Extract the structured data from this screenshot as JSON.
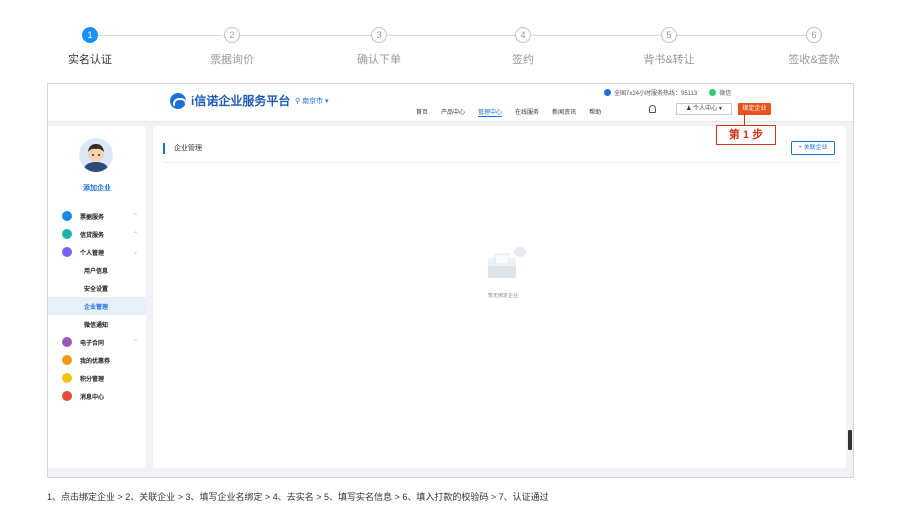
{
  "steps": [
    {
      "num": "1",
      "label": "实名认证",
      "active": true
    },
    {
      "num": "2",
      "label": "票据询价"
    },
    {
      "num": "3",
      "label": "确认下单"
    },
    {
      "num": "4",
      "label": "签约"
    },
    {
      "num": "5",
      "label": "背书&转让"
    },
    {
      "num": "6",
      "label": "签收&查款"
    }
  ],
  "header": {
    "brand": "i信诺企业服务平台",
    "city": "南京市 ▾",
    "hotline": "全国7x24小时服务热线：95113",
    "wechat": "微信",
    "nav": [
      "首页",
      "产品中心",
      "管理中心",
      "在线服务",
      "新闻资讯",
      "帮助"
    ],
    "user_center": "个人中心 ▾",
    "bind_button": "绑定企业"
  },
  "sidebar": {
    "add_company": "添加企业",
    "menu": [
      {
        "label": "票据服务",
        "icon": "ticket-icon",
        "color": "#1e88e5",
        "arrow": "^"
      },
      {
        "label": "信贷服务",
        "icon": "credit-icon",
        "color": "#20b2aa",
        "arrow": "^"
      },
      {
        "label": "个人管理",
        "icon": "user-icon",
        "color": "#7b61ff",
        "arrow": "v"
      },
      {
        "label": "用户信息",
        "sub": true
      },
      {
        "label": "安全设置",
        "sub": true
      },
      {
        "label": "企业管理",
        "sub": true,
        "selected": true
      },
      {
        "label": "微信通知",
        "sub": true
      },
      {
        "label": "电子合同",
        "icon": "contract-icon",
        "color": "#9b59b6",
        "arrow": "^"
      },
      {
        "label": "我的优惠券",
        "icon": "coupon-icon",
        "color": "#f39c12"
      },
      {
        "label": "积分管理",
        "icon": "points-icon",
        "color": "#f1c40f"
      },
      {
        "label": "消息中心",
        "icon": "message-icon",
        "color": "#e74c3c"
      }
    ]
  },
  "main": {
    "title": "企业管理",
    "link_button": "+ 关联企业",
    "empty_text": "暂无绑定企业"
  },
  "callout": "第 1 步",
  "footer": "1、点击绑定企业 > 2、关联企业 > 3、填写企业名绑定 > 4、去实名 > 5、填写实名信息 > 6、填入打款的校验码 > 7、认证通过"
}
